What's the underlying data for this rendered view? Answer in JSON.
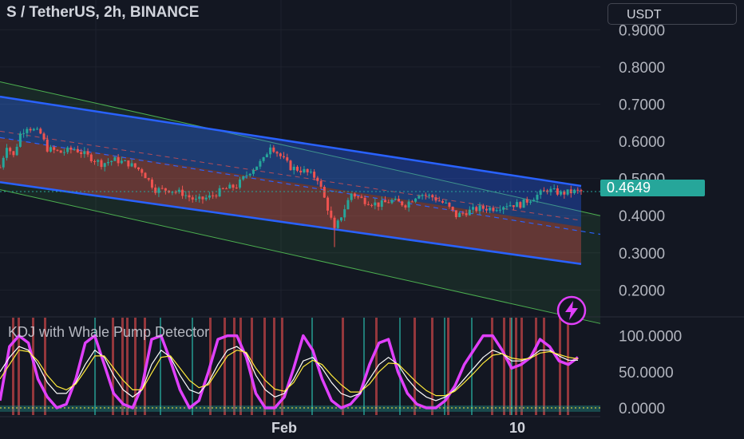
{
  "header": {
    "title": "S / TetherUS, 2h, BINANCE",
    "currency_label": "USDT",
    "indicator_title": "KDJ with Whale Pump Detector"
  },
  "colors": {
    "background": "#131722",
    "up": "#26a69a",
    "down": "#ef5350",
    "channel_line": "#2962ff",
    "outer_channel": "#4caf50",
    "k_line": "#e040fb",
    "d_line": "#ffffff",
    "j_line": "#ffeb3b",
    "signal_bar": "#ff5252"
  },
  "chart_data": [
    {
      "type": "candlestick",
      "title": "S / TetherUS, 2h, BINANCE",
      "x_tick_labels": [
        "Feb",
        "10"
      ],
      "y_axis_labels": [
        "0.9000",
        "0.8000",
        "0.7000",
        "0.6000",
        "0.5000",
        "0.4000",
        "0.3000",
        "0.2000"
      ],
      "ylim": [
        0.13,
        0.98
      ],
      "last_price_label": "0.4649",
      "last_price": 0.4649,
      "x_range": [
        0,
        172
      ],
      "close_path": [
        [
          0,
          0.53
        ],
        [
          2,
          0.59
        ],
        [
          4,
          0.56
        ],
        [
          6,
          0.62
        ],
        [
          8,
          0.64
        ],
        [
          10,
          0.63
        ],
        [
          12,
          0.62
        ],
        [
          14,
          0.58
        ],
        [
          18,
          0.57
        ],
        [
          22,
          0.58
        ],
        [
          26,
          0.56
        ],
        [
          30,
          0.54
        ],
        [
          34,
          0.55
        ],
        [
          38,
          0.54
        ],
        [
          42,
          0.52
        ],
        [
          46,
          0.47
        ],
        [
          50,
          0.47
        ],
        [
          54,
          0.46
        ],
        [
          58,
          0.44
        ],
        [
          62,
          0.45
        ],
        [
          66,
          0.47
        ],
        [
          70,
          0.48
        ],
        [
          74,
          0.52
        ],
        [
          78,
          0.55
        ],
        [
          80,
          0.59
        ],
        [
          82,
          0.57
        ],
        [
          86,
          0.53
        ],
        [
          90,
          0.52
        ],
        [
          94,
          0.5
        ],
        [
          97,
          0.42
        ],
        [
          99,
          0.36
        ],
        [
          101,
          0.4
        ],
        [
          104,
          0.46
        ],
        [
          108,
          0.44
        ],
        [
          112,
          0.43
        ],
        [
          116,
          0.44
        ],
        [
          120,
          0.43
        ],
        [
          124,
          0.46
        ],
        [
          128,
          0.45
        ],
        [
          132,
          0.43
        ],
        [
          135,
          0.4
        ],
        [
          138,
          0.41
        ],
        [
          142,
          0.42
        ],
        [
          146,
          0.42
        ],
        [
          150,
          0.43
        ],
        [
          154,
          0.43
        ],
        [
          158,
          0.45
        ],
        [
          162,
          0.47
        ],
        [
          166,
          0.46
        ],
        [
          170,
          0.465
        ]
      ],
      "regression_channel": {
        "upper": [
          0.72,
          0.48
        ],
        "middle": [
          0.61,
          0.37
        ],
        "lower": [
          0.49,
          0.27
        ]
      },
      "outer_channel": {
        "upper": [
          0.76,
          0.4
        ],
        "lower": [
          0.47,
          0.11
        ]
      }
    },
    {
      "type": "line",
      "title": "KDJ with Whale Pump Detector",
      "y_axis_labels": [
        "100.0000",
        "50.0000",
        "0.0000"
      ],
      "ylim": [
        -10,
        125
      ],
      "series": [
        {
          "values": [
            10,
            85,
            100,
            90,
            40,
            15,
            0,
            5,
            40,
            90,
            100,
            60,
            20,
            5,
            0,
            30,
            95,
            100,
            65,
            25,
            0,
            10,
            50,
            95,
            100,
            100,
            70,
            20,
            0,
            0,
            15,
            55,
            100,
            80,
            40,
            10,
            0,
            5,
            20,
            60,
            90,
            95,
            50,
            20,
            5,
            0,
            0,
            10,
            30,
            60,
            80,
            100,
            100,
            80,
            55,
            60,
            70,
            95,
            85,
            65,
            60,
            70
          ]
        },
        {
          "values": [
            50,
            70,
            85,
            80,
            60,
            35,
            20,
            20,
            35,
            60,
            80,
            70,
            45,
            25,
            15,
            25,
            60,
            80,
            70,
            45,
            25,
            20,
            35,
            60,
            80,
            85,
            75,
            45,
            25,
            15,
            20,
            40,
            65,
            70,
            55,
            35,
            20,
            15,
            20,
            40,
            60,
            70,
            60,
            40,
            25,
            15,
            10,
            15,
            25,
            40,
            55,
            70,
            80,
            75,
            65,
            65,
            70,
            80,
            80,
            72,
            66,
            66
          ]
        },
        {
          "values": [
            40,
            60,
            80,
            78,
            65,
            45,
            30,
            25,
            33,
            52,
            72,
            72,
            55,
            38,
            25,
            25,
            48,
            70,
            72,
            55,
            38,
            28,
            32,
            52,
            72,
            80,
            77,
            55,
            38,
            26,
            23,
            35,
            57,
            66,
            60,
            45,
            32,
            22,
            22,
            33,
            50,
            62,
            61,
            48,
            35,
            24,
            17,
            17,
            23,
            35,
            48,
            62,
            73,
            75,
            69,
            67,
            69,
            76,
            78,
            74,
            70,
            68
          ]
        }
      ]
    }
  ]
}
